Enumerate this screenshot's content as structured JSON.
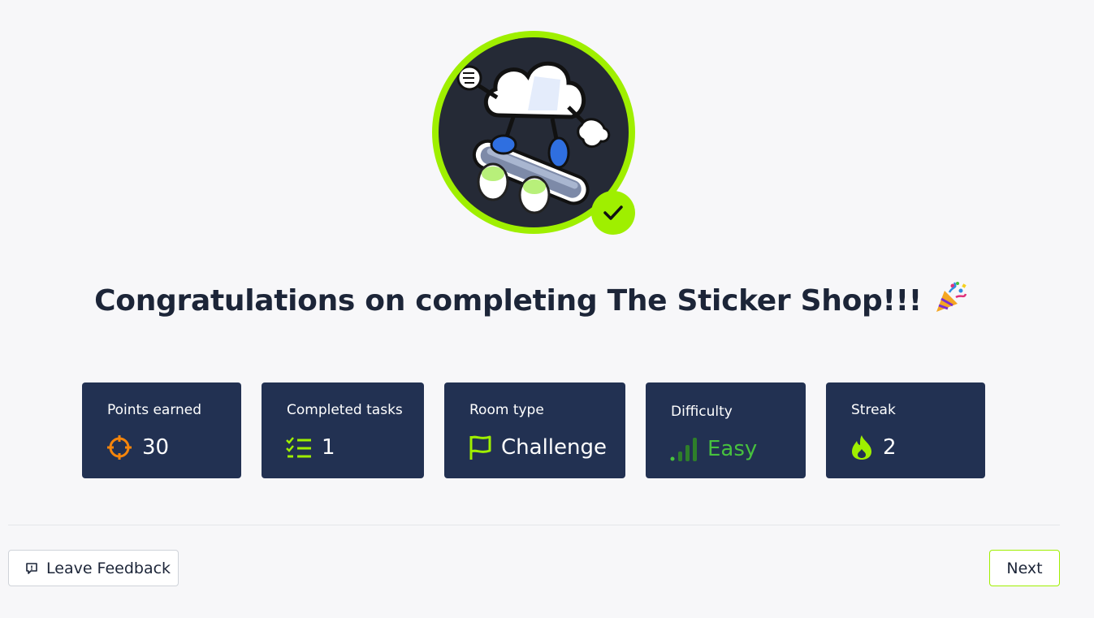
{
  "room": {
    "title": "Congratulations on completing The Sticker Shop!!!",
    "emoji": "🎉",
    "badge_icon": "skateboarding-cloud-sticker",
    "completed_icon": "check-icon"
  },
  "stats": [
    {
      "label": "Points earned",
      "value": "30",
      "icon": "crosshair-icon",
      "icon_color": "#f5850b"
    },
    {
      "label": "Completed tasks",
      "value": "1",
      "icon": "checklist-icon",
      "icon_color": "#9fef00"
    },
    {
      "label": "Room type",
      "value": "Challenge",
      "icon": "flag-icon",
      "icon_color": "#9fef00"
    },
    {
      "label": "Difficulty",
      "value": "Easy",
      "icon": "signal-bars-icon",
      "icon_color": "#47c13e"
    },
    {
      "label": "Streak",
      "value": "2",
      "icon": "flame-icon",
      "icon_color": "#9fef00"
    }
  ],
  "actions": {
    "feedback_label": "Leave Feedback",
    "feedback_icon": "message-alert-icon",
    "next_label": "Next"
  },
  "colors": {
    "accent": "#9fef00",
    "card_bg": "#223152",
    "page_bg": "#f7f7f9",
    "easy": "#47c13e"
  }
}
